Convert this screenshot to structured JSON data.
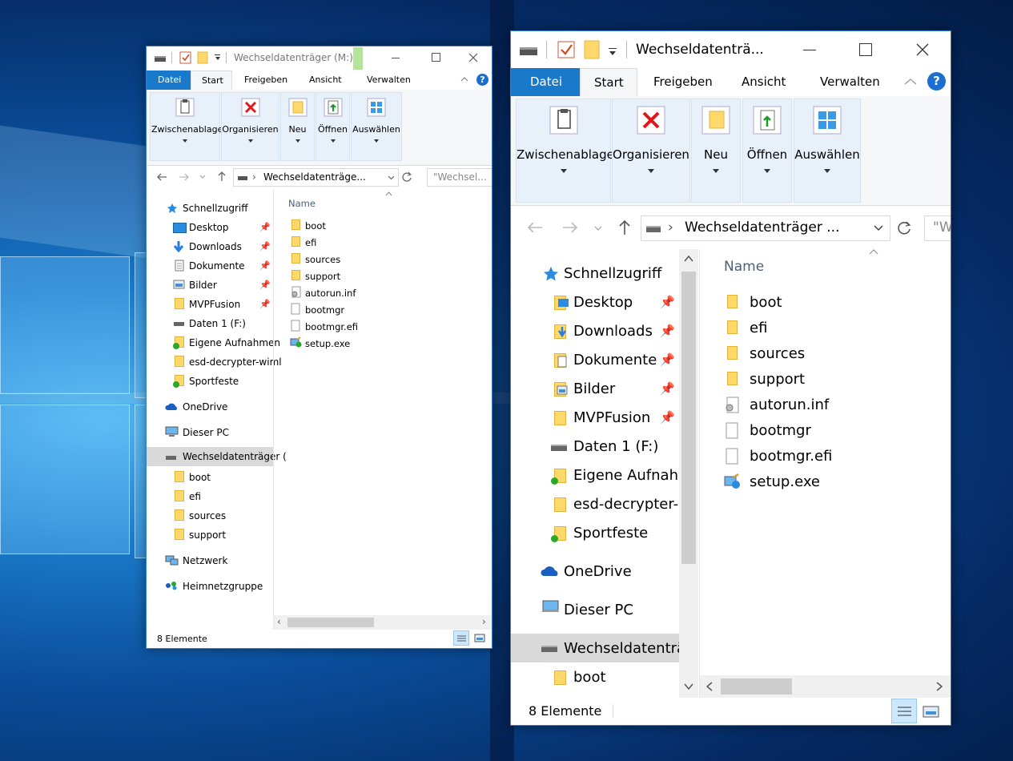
{
  "small": {
    "title": "Wechseldatenträger (M:)",
    "tabs": {
      "file": "Datei",
      "home": "Start",
      "share": "Freigeben",
      "view": "Ansicht",
      "manage": "Verwalten"
    },
    "ribbon": {
      "clipboard": "Zwischenablage",
      "organize": "Organisieren",
      "new": "Neu",
      "open": "Öffnen",
      "select": "Auswählen"
    },
    "address": "Wechseldatenträge...",
    "search_placeholder": "\"Wechsel...",
    "col_name": "Name",
    "nav": {
      "quick": "Schnellzugriff",
      "desktop": "Desktop",
      "downloads": "Downloads",
      "documents": "Dokumente",
      "pictures": "Bilder",
      "mvp": "MVPFusion",
      "data": "Daten 1 (F:)",
      "eigene": "Eigene Aufnahmen",
      "esd": "esd-decrypter-wiml",
      "sport": "Sportfeste",
      "onedrive": "OneDrive",
      "pc": "Dieser PC",
      "removable": "Wechseldatenträger (",
      "boot": "boot",
      "efi": "efi",
      "sources": "sources",
      "support": "support",
      "network": "Netzwerk",
      "homegroup": "Heimnetzgruppe"
    },
    "files": {
      "f1": "boot",
      "f2": "efi",
      "f3": "sources",
      "f4": "support",
      "f5": "autorun.inf",
      "f6": "bootmgr",
      "f7": "bootmgr.efi",
      "f8": "setup.exe"
    },
    "status": "8 Elemente"
  },
  "big": {
    "title": "Wechseldatenträ...",
    "tabs": {
      "file": "Datei",
      "home": "Start",
      "share": "Freigeben",
      "view": "Ansicht",
      "manage": "Verwalten"
    },
    "ribbon": {
      "clipboard": "Zwischenablage",
      "organize": "Organisieren",
      "new": "Neu",
      "open": "Öffnen",
      "select": "Auswählen"
    },
    "address": "Wechseldatenträger ...",
    "search_placeholder": "\"W",
    "col_name": "Name",
    "nav": {
      "quick": "Schnellzugriff",
      "desktop": "Desktop",
      "downloads": "Downloads",
      "documents": "Dokumente",
      "pictures": "Bilder",
      "mvp": "MVPFusion",
      "data": "Daten 1 (F:)",
      "eigene": "Eigene Aufnahm",
      "esd": "esd-decrypter-w",
      "sport": "Sportfeste",
      "onedrive": "OneDrive",
      "pc": "Dieser PC",
      "removable": "Wechseldatenträge",
      "boot": "boot"
    },
    "files": {
      "f1": "boot",
      "f2": "efi",
      "f3": "sources",
      "f4": "support",
      "f5": "autorun.inf",
      "f6": "bootmgr",
      "f7": "bootmgr.efi",
      "f8": "setup.exe"
    },
    "status": "8 Elemente"
  },
  "colors": {
    "accent": "#1979ca",
    "folder": "#ffd86b",
    "selection": "#cce8ff",
    "ribbon": "#e8f1fa",
    "manage_tab": "#b4e39a"
  },
  "icons": [
    "drive-icon",
    "properties-icon",
    "folder-icon",
    "pin-icon",
    "star-icon",
    "cloud-icon",
    "computer-icon",
    "network-icon",
    "homegroup-icon",
    "file-icon",
    "gear-file-icon",
    "setup-icon",
    "refresh-icon",
    "help-icon"
  ]
}
